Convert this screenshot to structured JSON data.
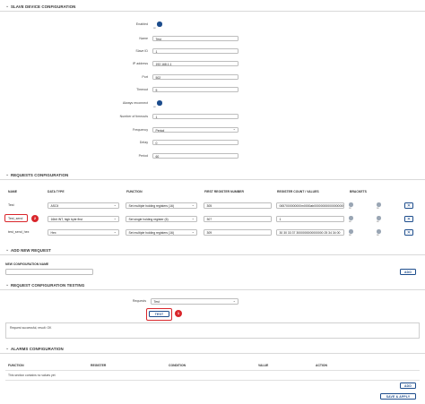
{
  "slave": {
    "title": "SLAVE DEVICE CONFIGURATION",
    "fields": [
      {
        "label": "Enabled",
        "type": "toggle",
        "sub": "on"
      },
      {
        "label": "Name",
        "type": "input",
        "value": "Test"
      },
      {
        "label": "Slave ID",
        "type": "input",
        "value": "1"
      },
      {
        "label": "IP address",
        "type": "input",
        "value": "192.168.1.1"
      },
      {
        "label": "Port",
        "type": "input",
        "value": "502"
      },
      {
        "label": "Timeout",
        "type": "input",
        "value": "5"
      },
      {
        "label": "Always reconnect",
        "type": "toggle",
        "sub": "on"
      },
      {
        "label": "Number of timeouts",
        "type": "input",
        "value": "1"
      },
      {
        "label": "Frequency",
        "type": "select",
        "value": "Period"
      },
      {
        "label": "Delay",
        "type": "input",
        "value": "0"
      },
      {
        "label": "Period",
        "type": "input",
        "value": "60"
      }
    ]
  },
  "requests": {
    "title": "REQUESTS CONFIGURATION",
    "columns": [
      "NAME",
      "DATA TYPE",
      "FUNCTION",
      "FIRST REGISTER NUMBER",
      "REGISTER COUNT / VALUES",
      "BRACKETS"
    ],
    "rows": [
      {
        "name": "Test",
        "data_type": "ASCII",
        "function": "Set multiple holding registers (16)",
        "first_register": "305",
        "count": "0657000000000m0000ab0000000000000000000"
      },
      {
        "name": "Test_send",
        "data_type": "16bit INT, high byte first",
        "function": "Set single holding register (6)",
        "first_register": "307",
        "count": "1"
      },
      {
        "name": "test_send_hex",
        "data_type": "Hex",
        "function": "Set multiple holding registers (16)",
        "first_register": "309",
        "count": "30 30 33 37 3000000000000000 25 34 34 00"
      }
    ],
    "toggle_sub": "on",
    "delete_glyph": "✕"
  },
  "add_request": {
    "title": "ADD NEW REQUEST",
    "field_label": "NEW CONFIGURATION NAME",
    "field_value": "",
    "add_label": "ADD"
  },
  "testing": {
    "title": "REQUEST CONFIGURATION TESTING",
    "requests_label": "Requests",
    "requests_value": "Test",
    "test_label": "TEST",
    "badge": "1",
    "result": "Request successful, result: OK"
  },
  "callout_badge": "2",
  "alarms": {
    "title": "ALARMS CONFIGURATION",
    "columns": [
      "FUNCTION",
      "REGISTER",
      "CONDITION",
      "VALUE",
      "ACTION"
    ],
    "empty_text": "This section contains no values yet",
    "add_label": "ADD"
  },
  "footer": {
    "save_label": "SAVE & APPLY"
  },
  "colors": {
    "accent": "#1c4c8c",
    "callout": "#d9262b"
  },
  "icons": {
    "section_chevron": "chevron-down-icon",
    "select_caret": "caret-down-icon",
    "delete": "close-icon"
  }
}
